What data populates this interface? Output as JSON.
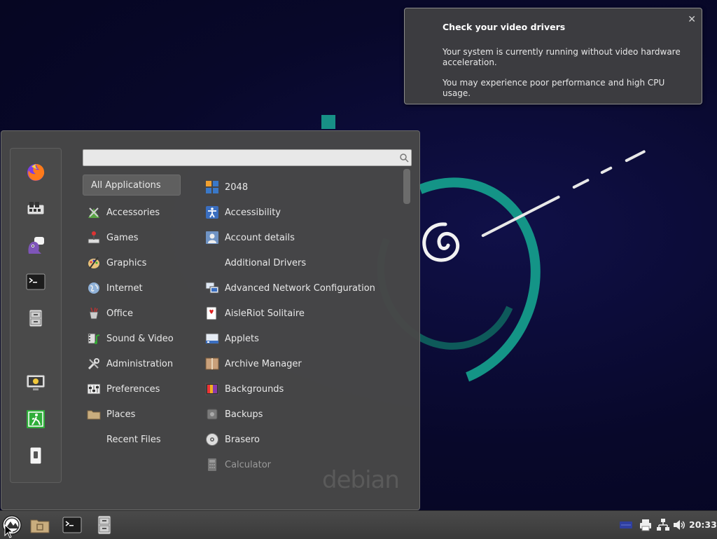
{
  "notification": {
    "title": "Check your video drivers",
    "line1": "Your system is currently running without video hardware acceleration.",
    "line2": "You may experience poor performance and high CPU usage.",
    "close_icon": "close-icon"
  },
  "menu": {
    "search": {
      "value": "",
      "placeholder": ""
    },
    "favorites": [
      "firefox-icon",
      "software-manager-icon",
      "pidgin-icon",
      "terminal-icon",
      "file-cabinet-icon",
      "lock-screen-icon",
      "logout-icon",
      "shutdown-icon"
    ],
    "categories": [
      {
        "label": "All Applications",
        "icon": "all-apps"
      },
      {
        "label": "Accessories",
        "icon": "accessories-icon"
      },
      {
        "label": "Games",
        "icon": "games-icon"
      },
      {
        "label": "Graphics",
        "icon": "graphics-icon"
      },
      {
        "label": "Internet",
        "icon": "internet-icon"
      },
      {
        "label": "Office",
        "icon": "office-icon"
      },
      {
        "label": "Sound & Video",
        "icon": "sound-video-icon"
      },
      {
        "label": "Administration",
        "icon": "administration-icon"
      },
      {
        "label": "Preferences",
        "icon": "preferences-icon"
      },
      {
        "label": "Places",
        "icon": "places-icon"
      },
      {
        "label": "Recent Files",
        "icon": ""
      }
    ],
    "apps": [
      {
        "label": "2048",
        "icon": "2048-icon"
      },
      {
        "label": "Accessibility",
        "icon": "accessibility-icon"
      },
      {
        "label": "Account details",
        "icon": "account-details-icon"
      },
      {
        "label": "Additional Drivers",
        "icon": ""
      },
      {
        "label": "Advanced Network Configuration",
        "icon": "network-config-icon"
      },
      {
        "label": "AisleRiot Solitaire",
        "icon": "solitaire-icon"
      },
      {
        "label": "Applets",
        "icon": "applets-icon"
      },
      {
        "label": "Archive Manager",
        "icon": "archive-manager-icon"
      },
      {
        "label": "Backgrounds",
        "icon": "backgrounds-icon"
      },
      {
        "label": "Backups",
        "icon": "backups-icon"
      },
      {
        "label": "Brasero",
        "icon": "brasero-icon"
      },
      {
        "label": "Calculator",
        "icon": "calculator-icon"
      }
    ],
    "watermark": "debian"
  },
  "taskbar": {
    "clock": "20:33",
    "launchers": [
      "menu-button-icon",
      "files-icon",
      "terminal-icon",
      "file-cabinet-icon"
    ],
    "tray": [
      "keyboard-layout-icon",
      "printer-icon",
      "network-icon",
      "volume-icon"
    ]
  },
  "colors": {
    "accent": "#15a38f",
    "menu_bg": "#484848",
    "taskbar_bg": "#3f3f3f"
  }
}
